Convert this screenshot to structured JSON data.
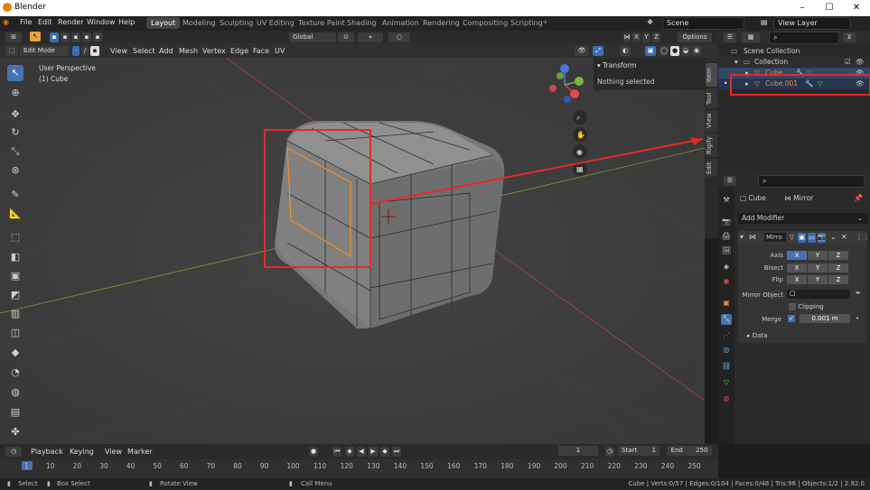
{
  "window": {
    "title": "Blender",
    "minimize": "–",
    "maximize": "☐",
    "close": "✕"
  },
  "menu": [
    "File",
    "Edit",
    "Render",
    "Window",
    "Help"
  ],
  "workspaces": [
    "Layout",
    "Modeling",
    "Sculpting",
    "UV Editing",
    "Texture Paint",
    "Shading",
    "Animation",
    "Rendering",
    "Compositing",
    "Scripting"
  ],
  "scene": {
    "name": "Scene",
    "view_layer": "View Layer"
  },
  "header": {
    "transform_orientation": "Global",
    "axes": [
      "X",
      "Y",
      "Z"
    ],
    "options": "Options",
    "mode": "Edit Mode",
    "menus": [
      "View",
      "Select",
      "Add",
      "Mesh",
      "Vertex",
      "Edge",
      "Face",
      "UV"
    ]
  },
  "viewport": {
    "perspective": "User Perspective",
    "object": "(1) Cube"
  },
  "npanel": {
    "section": "Transform",
    "message": "Nothing selected",
    "tabs": [
      "Item",
      "Tool",
      "View",
      "Rigify",
      "Edit"
    ]
  },
  "outliner": {
    "scene_collection": "Scene Collection",
    "collection": "Collection",
    "items": [
      "Cube",
      "Cube.001"
    ]
  },
  "properties": {
    "object": "Cube",
    "modifier_name_header": "Mirror",
    "add_modifier": "Add Modifier",
    "modifier": "Mirro",
    "axis_label": "Axis",
    "bisect_label": "Bisect",
    "flip_label": "Flip",
    "mirror_object_label": "Mirror Object",
    "clipping_label": "Clipping",
    "merge_label": "Merge",
    "merge_value": "0.001 m",
    "data_label": "Data",
    "axis_on": "X"
  },
  "timeline": {
    "menus": [
      "Playback",
      "Keying",
      "View",
      "Marker"
    ],
    "current_frame": "1",
    "start_label": "Start",
    "start": "1",
    "end_label": "End",
    "end": "250",
    "ticks": [
      "1",
      "10",
      "20",
      "30",
      "40",
      "50",
      "60",
      "70",
      "80",
      "90",
      "100",
      "110",
      "120",
      "130",
      "140",
      "150",
      "160",
      "170",
      "180",
      "190",
      "200",
      "210",
      "220",
      "230",
      "240",
      "250"
    ]
  },
  "status": {
    "select": "Select",
    "box_select": "Box Select",
    "rotate_view": "Rotate View",
    "call_menu": "Call Menu",
    "stats": "Cube | Verts:0/57 | Edges:0/104 | Faces:0/48 | Tris:96 | Objects:1/2 | 2.92.0"
  },
  "colors": {
    "accent": "#4772b3",
    "highlight": "#e32b2b",
    "selected_object": "#f28d2b"
  }
}
